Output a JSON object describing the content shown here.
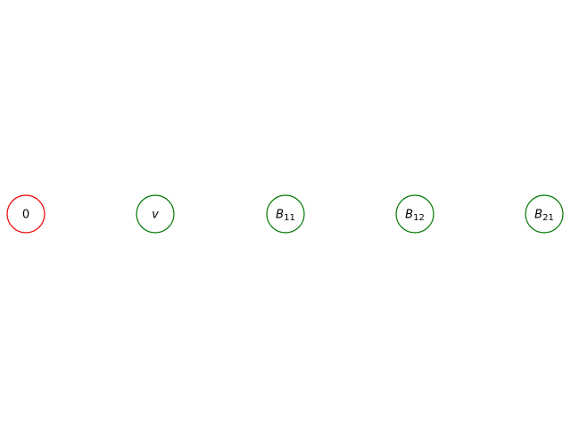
{
  "nodes": [
    {
      "id": "0",
      "symbol": "0",
      "italic": false,
      "subscript": "",
      "color": "#ee0000"
    },
    {
      "id": "v",
      "symbol": "v",
      "italic": true,
      "subscript": "",
      "color": "#007700"
    },
    {
      "id": "B11",
      "symbol": "B",
      "italic": true,
      "subscript": "11",
      "color": "#007700"
    },
    {
      "id": "B12",
      "symbol": "B",
      "italic": true,
      "subscript": "12",
      "color": "#007700"
    },
    {
      "id": "B21",
      "symbol": "B",
      "italic": true,
      "subscript": "21",
      "color": "#007700"
    }
  ]
}
